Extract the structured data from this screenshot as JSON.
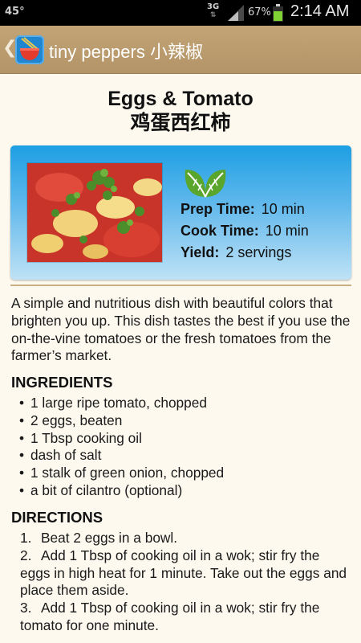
{
  "status_bar": {
    "temperature": "45°",
    "network": "3G",
    "battery_percent": "67%",
    "time": "2:14 AM"
  },
  "action_bar": {
    "up_glyph": "❮",
    "app_title": "tiny peppers 小辣椒",
    "logo_icon": "bowl-chopsticks-icon"
  },
  "recipe": {
    "title": "Eggs & Tomato",
    "title_cn": "鸡蛋西红柿",
    "photo": "dish-photo",
    "badge_icon": "leaf-icon",
    "prep_time_label": "Prep Time:",
    "prep_time_value": "10 min",
    "cook_time_label": "Cook Time:",
    "cook_time_value": "10 min",
    "yield_label": "Yield:",
    "yield_value": "2 servings",
    "intro": "A simple and nutritious dish with beautiful colors that brighten you up. This dish tastes the best if you use the on-the-vine tomatoes or the fresh tomatoes from the farmer’s market."
  },
  "ingredients": {
    "heading": "INGREDIENTS",
    "bullet": "•",
    "items": [
      "1 large ripe tomato, chopped",
      "2 eggs, beaten",
      "1 Tbsp cooking oil",
      "dash of salt",
      "1 stalk of green onion, chopped",
      "a bit of cilantro (optional)"
    ]
  },
  "directions": {
    "heading": "DIRECTIONS",
    "steps": [
      {
        "num": "1.",
        "text": "Beat 2 eggs in a bowl."
      },
      {
        "num": "2.",
        "text": "Add 1 Tbsp of cooking oil in a wok; stir fry the eggs in high heat for 1 minute. Take out the eggs and place them aside."
      },
      {
        "num": "3.",
        "text": "Add 1 Tbsp of cooking oil in a wok; stir fry the tomato for one minute."
      }
    ]
  },
  "colors": {
    "action_bar": "#b89a6c",
    "card_top": "#1d9fe3",
    "card_bottom": "#bfe2f6",
    "background": "#fdf9ef",
    "leaf": "#5aa52c"
  }
}
